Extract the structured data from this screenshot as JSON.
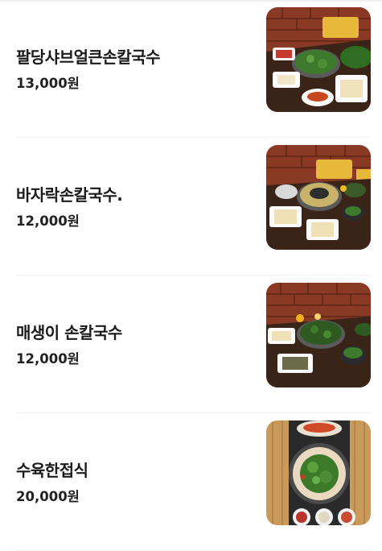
{
  "menu": {
    "items": [
      {
        "name": "팔당샤브얼큰손칼국수",
        "price": "13,000원",
        "photo": "food-photo-spicy-shabu-noodle"
      },
      {
        "name": "바자락손칼국수.",
        "price": "12,000원",
        "photo": "food-photo-clam-noodle"
      },
      {
        "name": "매생이 손칼국수",
        "price": "12,000원",
        "photo": "food-photo-seaweed-noodle"
      },
      {
        "name": "수육한접식",
        "price": "20,000원",
        "photo": "food-photo-boiled-pork-platter"
      }
    ]
  }
}
